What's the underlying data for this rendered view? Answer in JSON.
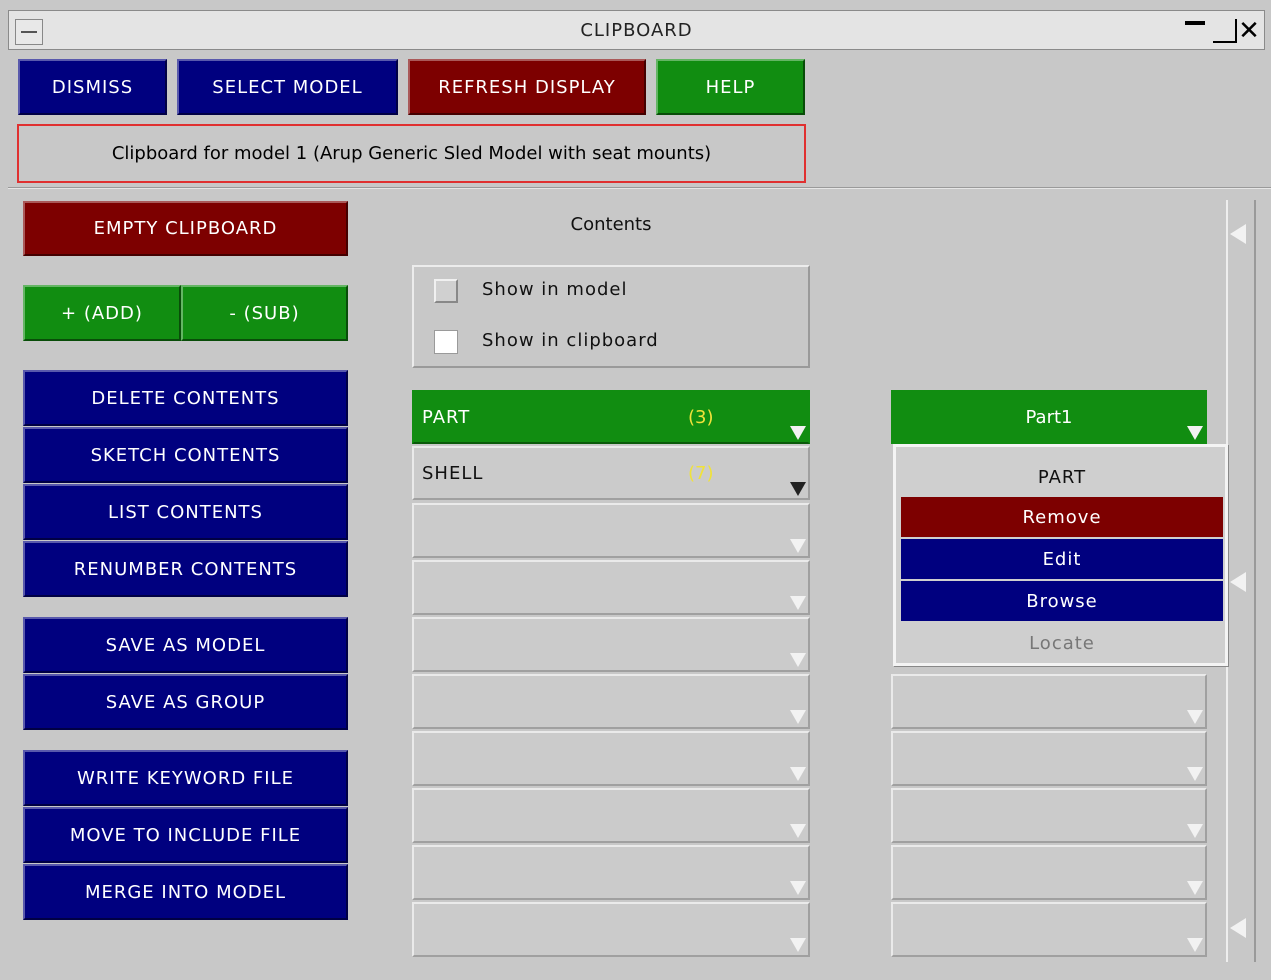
{
  "window": {
    "title": "CLIPBOARD"
  },
  "toolbar": {
    "dismiss": "DISMISS",
    "select_model": "SELECT MODEL",
    "refresh_display": "REFRESH DISPLAY",
    "help": "HELP"
  },
  "message": "Clipboard for model 1 (Arup Generic Sled Model with seat mounts)",
  "left_panel": {
    "empty_clipboard": "EMPTY CLIPBOARD",
    "add": "+ (ADD)",
    "sub": "- (SUB)",
    "delete_contents": "DELETE CONTENTS",
    "sketch_contents": "SKETCH CONTENTS",
    "list_contents": "LIST CONTENTS",
    "renumber_contents": "RENUMBER CONTENTS",
    "save_as_model": "SAVE AS MODEL",
    "save_as_group": "SAVE AS GROUP",
    "write_keyword_file": "WRITE KEYWORD FILE",
    "move_to_include_file": "MOVE TO INCLUDE FILE",
    "merge_into_model": "MERGE INTO MODEL"
  },
  "contents": {
    "heading": "Contents",
    "show_in_model": "Show in model",
    "show_in_clipboard": "Show in clipboard",
    "rows": [
      {
        "label": "PART",
        "count": "(3)"
      },
      {
        "label": "SHELL",
        "count": "(7)"
      }
    ]
  },
  "item_list": {
    "selected": "Part1"
  },
  "popup_menu": {
    "header": "PART",
    "remove": "Remove",
    "edit": "Edit",
    "browse": "Browse",
    "locate": "Locate"
  },
  "colors": {
    "blue": "#00007f",
    "red": "#7d0000",
    "green": "#118d11",
    "count_yellow": "#f0e23a"
  }
}
